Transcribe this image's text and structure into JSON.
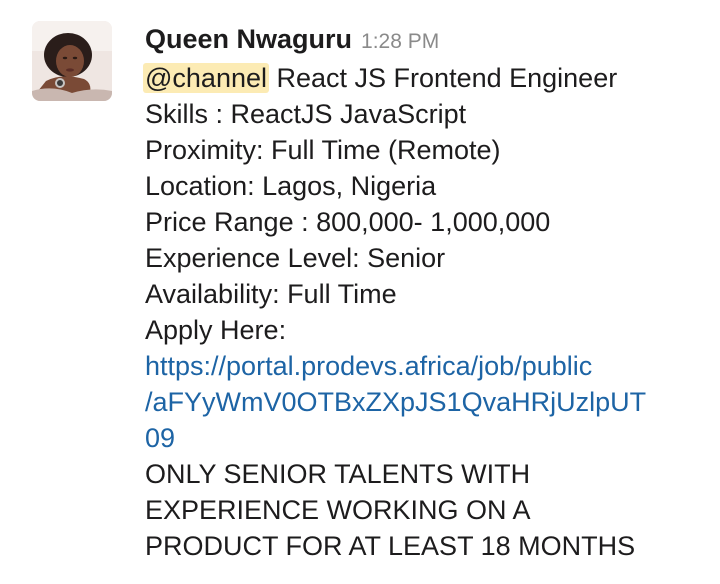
{
  "message": {
    "author": "Queen Nwaguru",
    "timestamp": "1:28 PM",
    "mention": "@channel",
    "title": "React JS Frontend Engineer",
    "lines": [
      "Skills : ReactJS JavaScript",
      "Proximity: Full Time (Remote)",
      "Location: Lagos, Nigeria",
      "Price Range : 800,000- 1,000,000",
      "Experience Level: Senior",
      "Availability: Full Time",
      "Apply Here:"
    ],
    "link": {
      "line1": "https://portal.prodevs.africa/job/public",
      "line2": "/aFYyWmV0OTBxZXpJS1QvaHRjUzlpUT",
      "line3": "09"
    },
    "closing": [
      "ONLY SENIOR TALENTS WITH",
      "EXPERIENCE WORKING ON A",
      "PRODUCT FOR AT LEAST 18 MONTHS"
    ]
  },
  "icons": {
    "avatar": "user-avatar-photo"
  }
}
